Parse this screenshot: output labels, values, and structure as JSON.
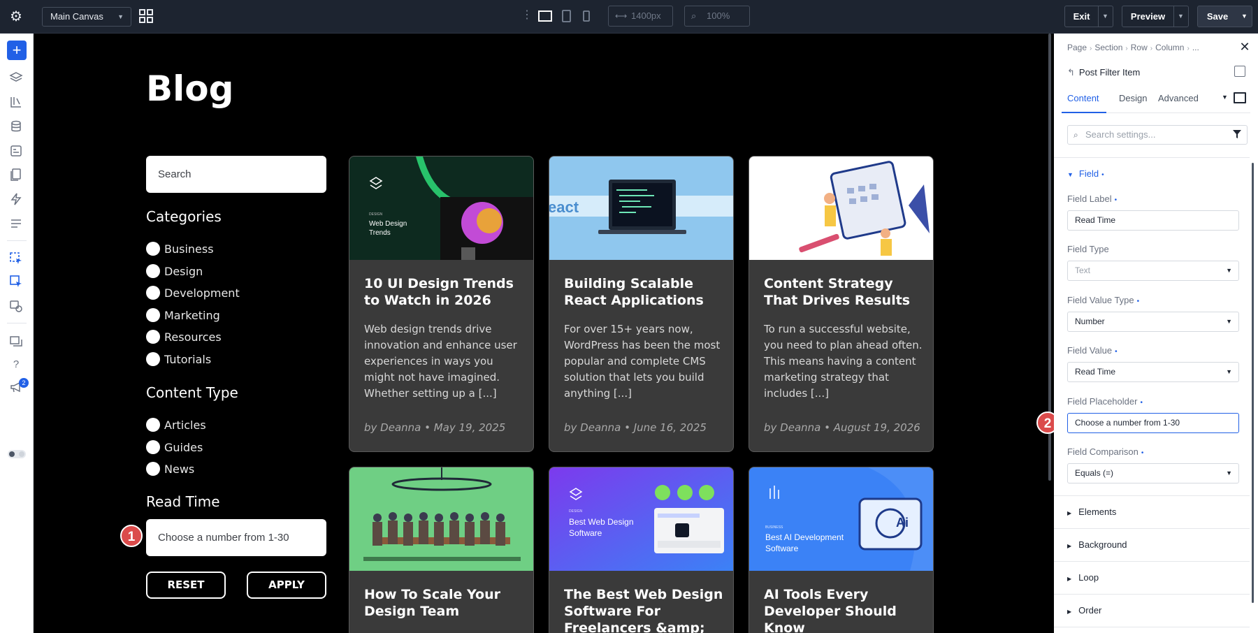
{
  "topbar": {
    "canvas_select": "Main Canvas",
    "width_value": "1400px",
    "zoom_value": "100%",
    "exit_label": "Exit",
    "preview_label": "Preview",
    "save_label": "Save"
  },
  "leftbar": {
    "notification_count": "2"
  },
  "blog": {
    "title": "Blog",
    "search_placeholder": "Search",
    "categories_heading": "Categories",
    "categories": [
      "Business",
      "Design",
      "Development",
      "Marketing",
      "Resources",
      "Tutorials"
    ],
    "content_type_heading": "Content Type",
    "content_types": [
      "Articles",
      "Guides",
      "News"
    ],
    "read_time_heading": "Read Time",
    "read_time_placeholder": "Choose a number from 1-30",
    "reset_label": "RESET",
    "apply_label": "APPLY"
  },
  "markers": {
    "one": "1",
    "two": "2"
  },
  "posts": [
    {
      "title": "10 UI Design Trends to Watch in 2026",
      "excerpt": "Web design trends drive innovation and enhance user experiences in ways you might not have imagined. Whether setting up a [...]",
      "meta": "by Deanna • May 19, 2025",
      "image_caption_small": "DESIGN",
      "image_caption": "Web Design Trends"
    },
    {
      "title": "Building Scalable React Applications",
      "excerpt": "For over 15+ years now, WordPress has been the most popular and complete CMS solution that lets you build anything [...]",
      "meta": "by Deanna • June 16, 2025",
      "image_caption": "eact"
    },
    {
      "title": "Content Strategy That Drives Results",
      "excerpt": "To run a successful website, you need to plan ahead often. This means having a content marketing strategy that includes [...]",
      "meta": "by Deanna • August 19, 2026"
    },
    {
      "title": "How To Scale Your Design Team"
    },
    {
      "title": "The Best Web Design Software For Freelancers &amp;",
      "image_caption_small": "DESIGN",
      "image_caption": "Best Web Design Software"
    },
    {
      "title": "AI Tools Every Developer Should Know",
      "image_caption_small": "BUSINESS",
      "image_caption": "Best AI Development Software"
    }
  ],
  "panel": {
    "breadcrumbs": [
      "Page",
      "Section",
      "Row",
      "Column",
      "..."
    ],
    "module_name": "Post Filter Item",
    "tabs": [
      "Content",
      "Design",
      "Advanced"
    ],
    "search_placeholder": "Search settings...",
    "field_section": "Field",
    "field_label_label": "Field Label",
    "field_label_value": "Read Time",
    "field_type_label": "Field Type",
    "field_type_value": "Text",
    "field_value_type_label": "Field Value Type",
    "field_value_type_value": "Number",
    "field_value_label": "Field Value",
    "field_value_value": "Read Time",
    "field_placeholder_label": "Field Placeholder",
    "field_placeholder_value": "Choose a number from 1-30",
    "field_comparison_label": "Field Comparison",
    "field_comparison_value": "Equals (=)",
    "sections": [
      "Elements",
      "Background",
      "Loop",
      "Order"
    ]
  },
  "colors": {
    "accent": "#2160e6",
    "marker": "#db4b4b",
    "card_bg": "#3a3a3a"
  }
}
